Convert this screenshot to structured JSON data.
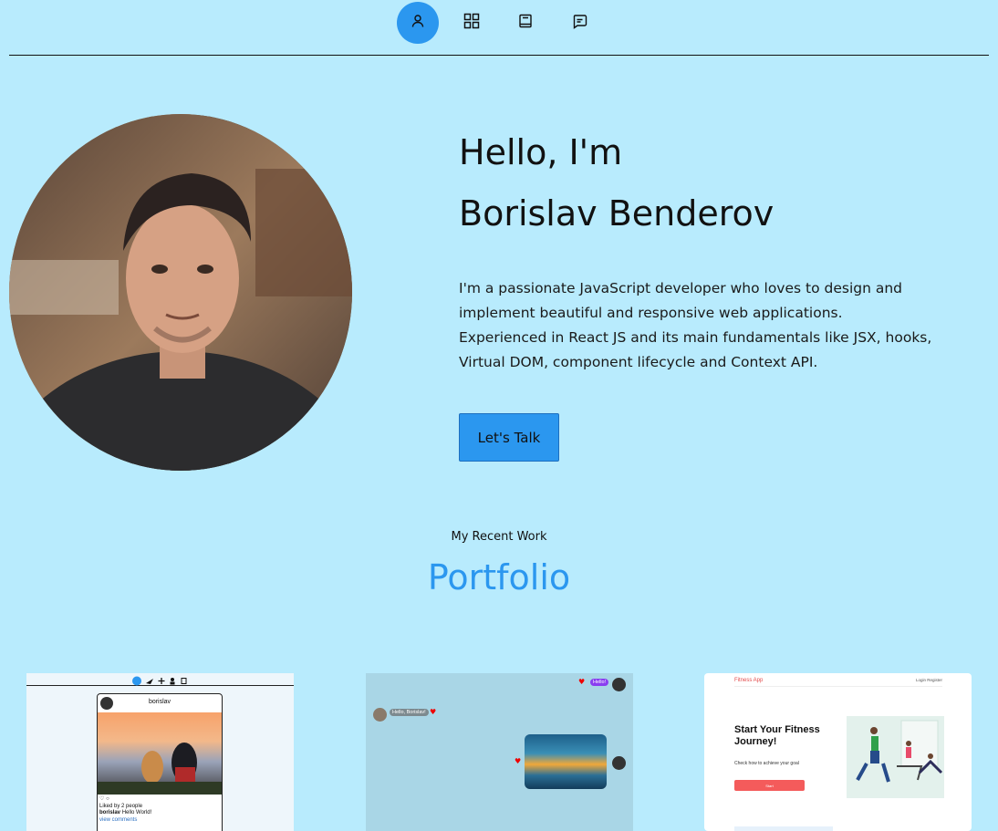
{
  "nav": {
    "items": [
      {
        "icon": "user-icon",
        "active": true
      },
      {
        "icon": "grid-icon",
        "active": false
      },
      {
        "icon": "book-icon",
        "active": false
      },
      {
        "icon": "message-icon",
        "active": false
      }
    ],
    "accent": "#2b97ef"
  },
  "hero": {
    "greeting": "Hello, I'm",
    "name": "Borislav Benderov",
    "description": "I'm a passionate JavaScript developer who loves to design and implement beautiful and responsive web applications. Experienced in React JS and its main fundamentals like JSX, hooks, Virtual DOM, component lifecycle and Context API.",
    "cta_label": "Let's Talk"
  },
  "portfolio": {
    "subtitle": "My Recent Work",
    "title": "Portfolio",
    "cards": [
      {
        "username": "borislav",
        "liked_by": "Liked by 2 people",
        "caption_user": "borislav",
        "caption_text": "Hello World!",
        "comments_link": "view comments"
      },
      {
        "msg_sent": "Hello!",
        "msg_received": "Hello, Borislav!"
      },
      {
        "brand": "Fitness App",
        "nav_links": "Login Register",
        "headline": "Start Your Fitness Journey!",
        "subtext": "Check how to achieve your goal",
        "button": "Start"
      }
    ]
  },
  "colors": {
    "background": "#b8ebfd",
    "accent": "#2b97ef"
  }
}
